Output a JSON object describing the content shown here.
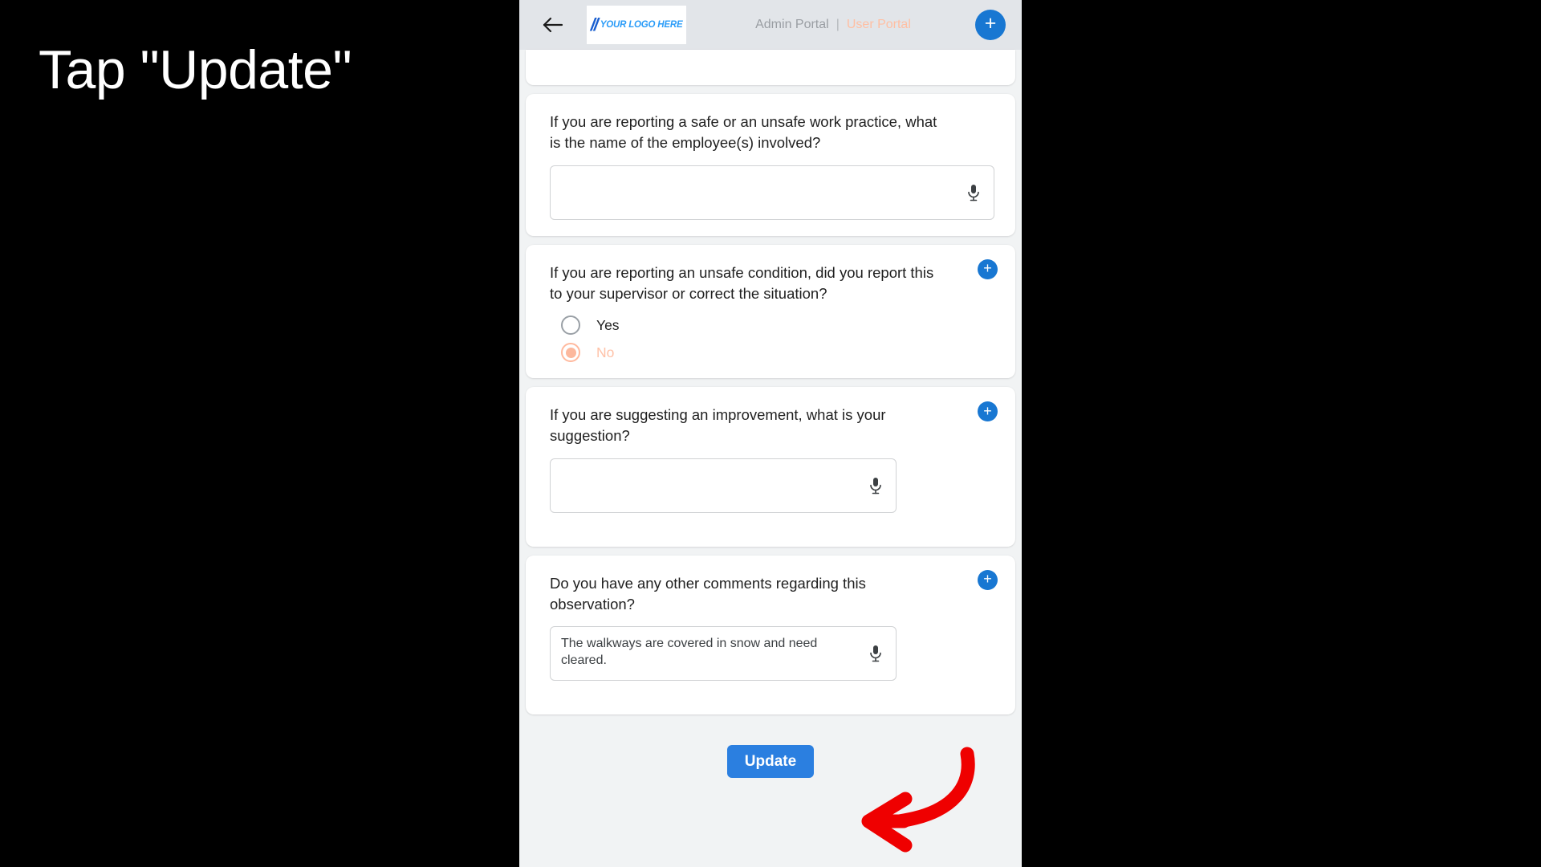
{
  "caption": {
    "text": "Tap \"Update\""
  },
  "header": {
    "back_icon": "arrow-left-icon",
    "logo_mark": "//",
    "logo_text": "YOUR LOGO HERE",
    "admin_portal": "Admin Portal",
    "separator": "|",
    "user_portal": "User Portal",
    "plus_label": "+",
    "bg_color": "#e2e5e9",
    "accent_blue": "#1877d2",
    "user_portal_color": "#ffbfa3"
  },
  "cards": [
    {
      "id": "employee-name",
      "question": "If you are reporting a safe or an unsafe work practice, what is the name of the employee(s) involved?",
      "input_value": "",
      "mic_icon": "microphone-icon",
      "has_plus": false
    },
    {
      "id": "unsafe-condition-reported",
      "question": "If you are reporting an unsafe condition, did you report this to your supervisor or correct the situation?",
      "has_plus": true,
      "plus_label": "+",
      "options": [
        {
          "label": "Yes",
          "selected": false
        },
        {
          "label": "No",
          "selected": true
        }
      ]
    },
    {
      "id": "suggestion",
      "question": "If you are suggesting an improvement, what is your suggestion?",
      "input_value": "",
      "mic_icon": "microphone-icon",
      "has_plus": true,
      "plus_label": "+"
    },
    {
      "id": "other-comments",
      "question": "Do you have any other comments regarding this observation?",
      "input_value": "The walkways are covered in snow and need cleared.",
      "mic_icon": "microphone-icon",
      "has_plus": true,
      "plus_label": "+"
    }
  ],
  "footer": {
    "update_label": "Update",
    "update_color": "#2b7fe0"
  },
  "annotation": {
    "arrow_icon": "red-curved-arrow-icon",
    "arrow_color": "#ef0000"
  }
}
